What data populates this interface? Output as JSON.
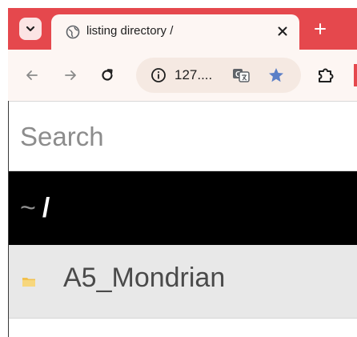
{
  "browser": {
    "tab": {
      "title": "listing directory /"
    },
    "omnibox": {
      "url": "127...."
    },
    "colors": {
      "tabstrip": "#e5484d",
      "toolbar": "#fdf6f3",
      "star": "#5b7fc7"
    },
    "icons": {
      "tab_search": "chevron-down-icon",
      "favicon": "globe-icon",
      "close": "close-icon",
      "new_tab": "plus-icon",
      "back": "arrow-left-icon",
      "forward": "arrow-right-icon",
      "reload": "reload-icon",
      "site_info": "info-icon",
      "translate": "translate-icon",
      "bookmark": "star-icon",
      "extensions": "puzzle-icon"
    }
  },
  "page": {
    "search": {
      "placeholder": "Search"
    },
    "breadcrumb": {
      "home": "~",
      "root": "/"
    },
    "files": [
      {
        "name": "A5_Mondrian",
        "type": "folder"
      }
    ],
    "colors": {
      "path_bar": "#000000",
      "file_row": "#e8e8e8",
      "folder": "#f2c14e"
    }
  }
}
